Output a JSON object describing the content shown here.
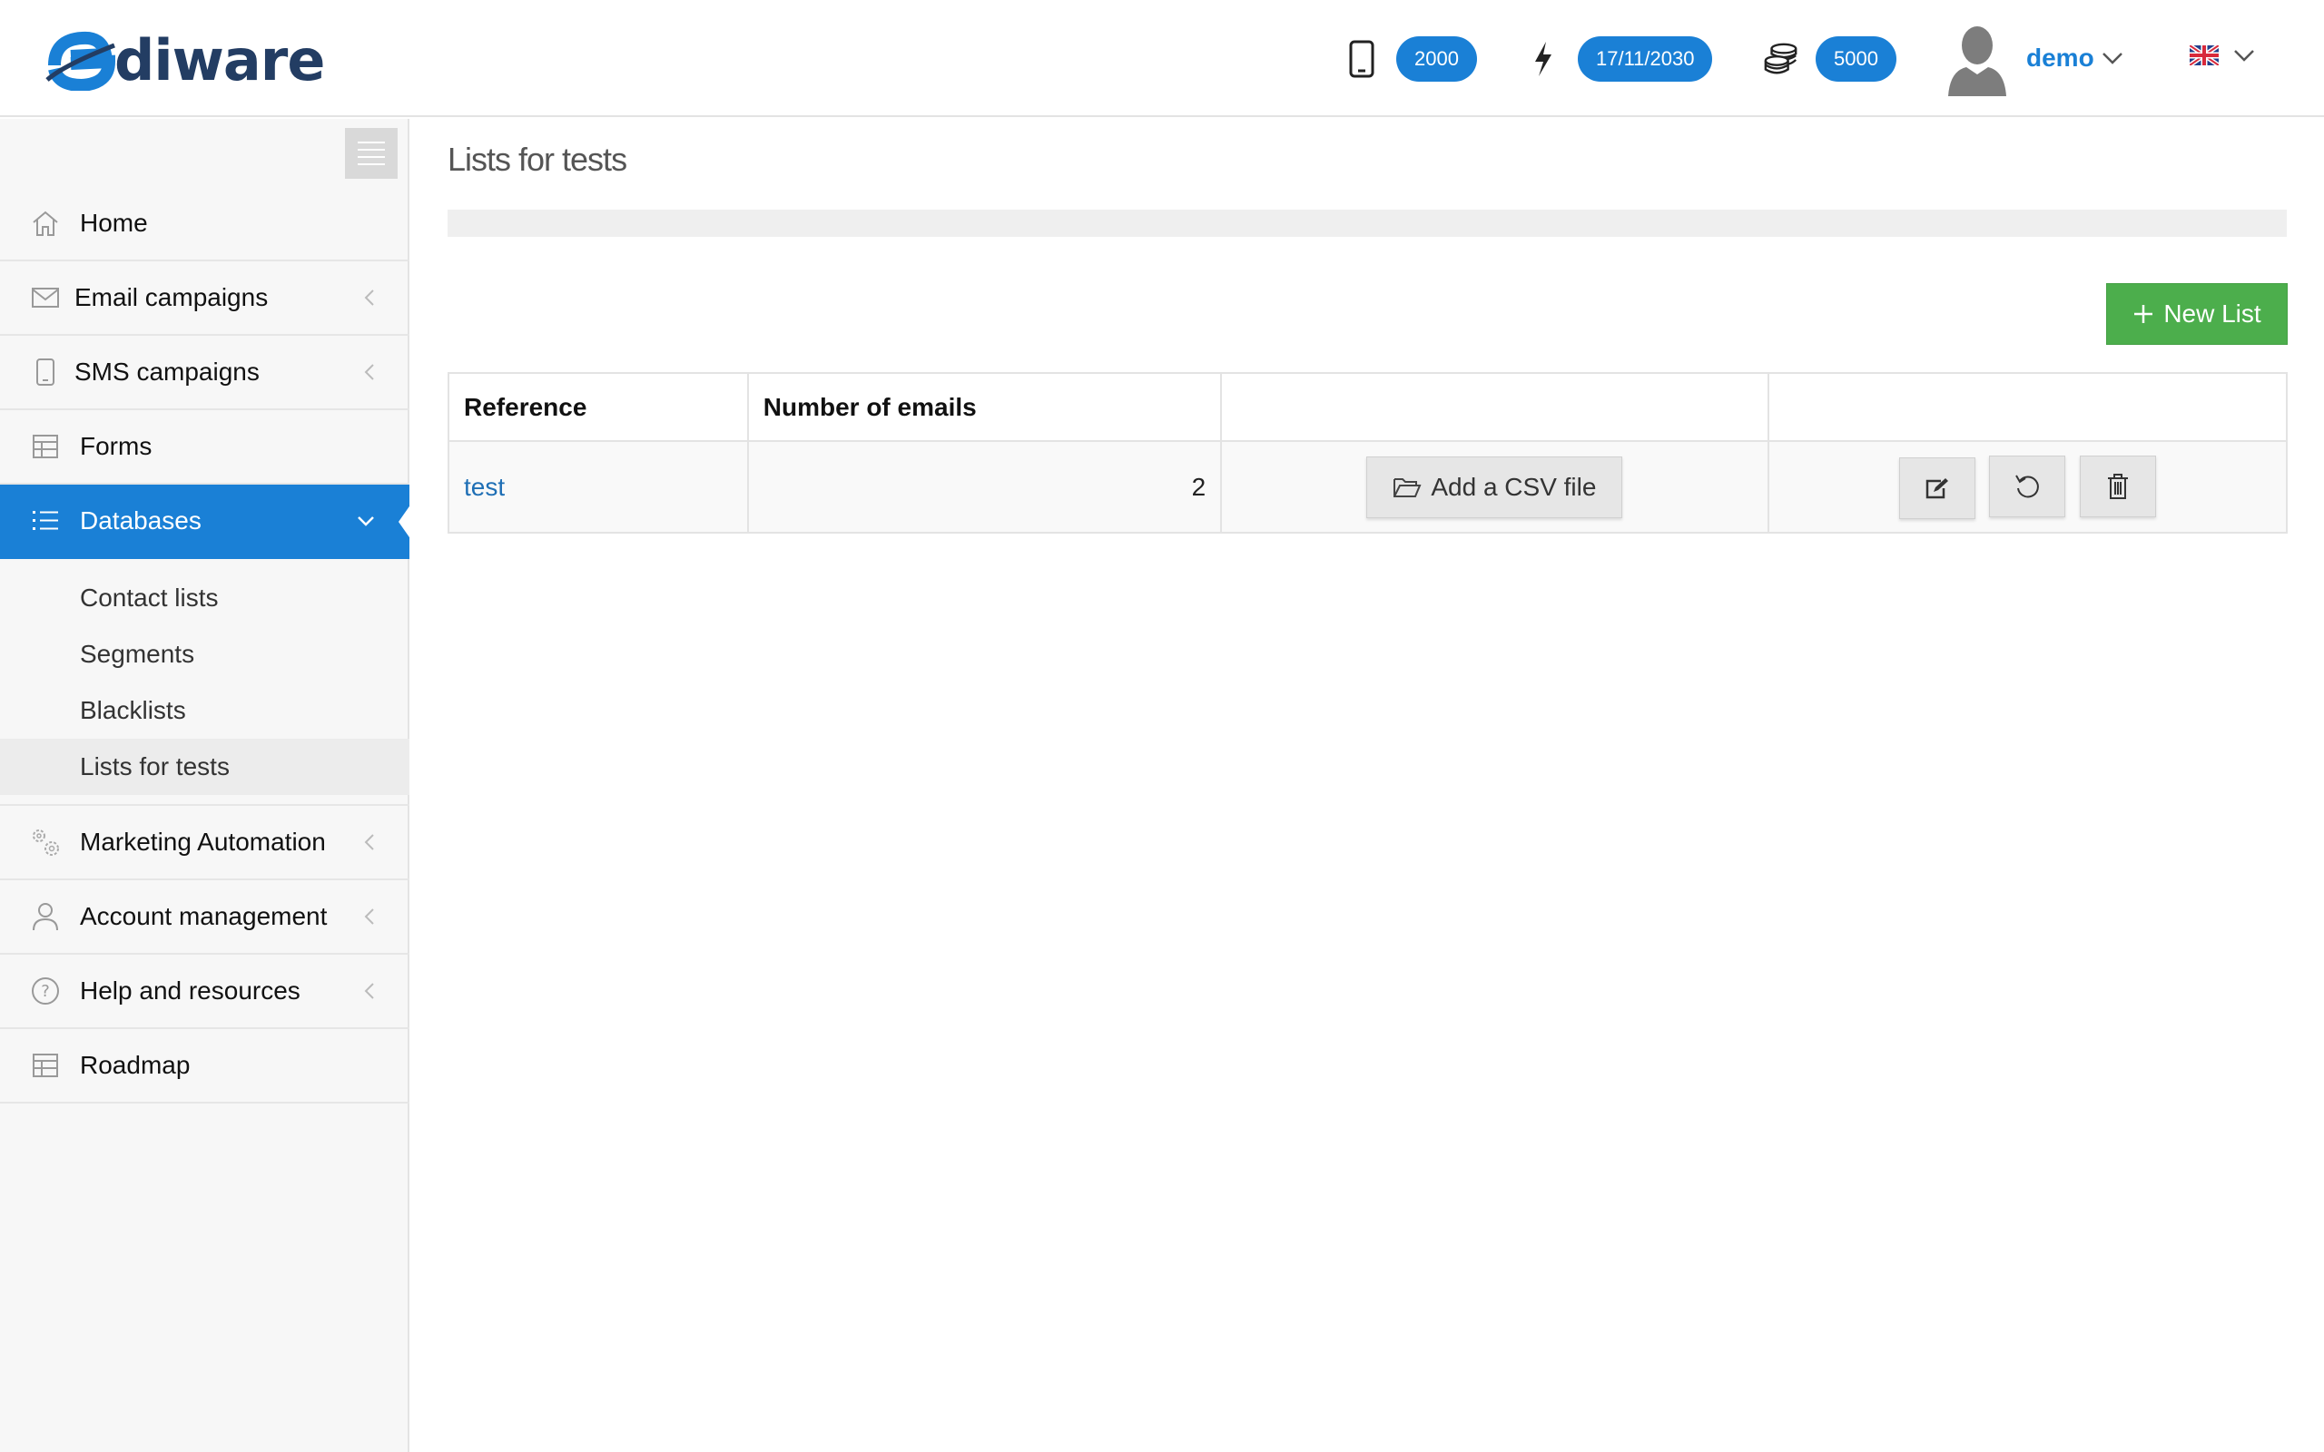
{
  "header": {
    "logo_e": "e",
    "logo_text": "diware",
    "sms_credits": "2000",
    "expiry_date": "17/11/2030",
    "email_credits": "5000",
    "user_name": "demo",
    "colors": {
      "accent": "#1a80d6",
      "logo": "#233d63",
      "success": "#4cae4c"
    }
  },
  "sidebar": {
    "items": [
      {
        "label": "Home",
        "icon": "home-icon"
      },
      {
        "label": "Email campaigns",
        "icon": "envelope-icon"
      },
      {
        "label": "SMS campaigns",
        "icon": "phone-icon"
      },
      {
        "label": "Forms",
        "icon": "table-icon"
      },
      {
        "label": "Databases",
        "icon": "list-icon"
      },
      {
        "label": "Marketing Automation",
        "icon": "gears-icon"
      },
      {
        "label": "Account management",
        "icon": "user-icon"
      },
      {
        "label": "Help and resources",
        "icon": "help-icon"
      },
      {
        "label": "Roadmap",
        "icon": "table-icon"
      }
    ],
    "submenu": [
      "Contact lists",
      "Segments",
      "Blacklists",
      "Lists for tests"
    ]
  },
  "main": {
    "title": "Lists for tests",
    "new_button": "New List",
    "table": {
      "headers": [
        "Reference",
        "Number of emails",
        "",
        ""
      ],
      "rows": [
        {
          "reference": "test",
          "count": "2",
          "csv_button": "Add a CSV file"
        }
      ]
    }
  }
}
